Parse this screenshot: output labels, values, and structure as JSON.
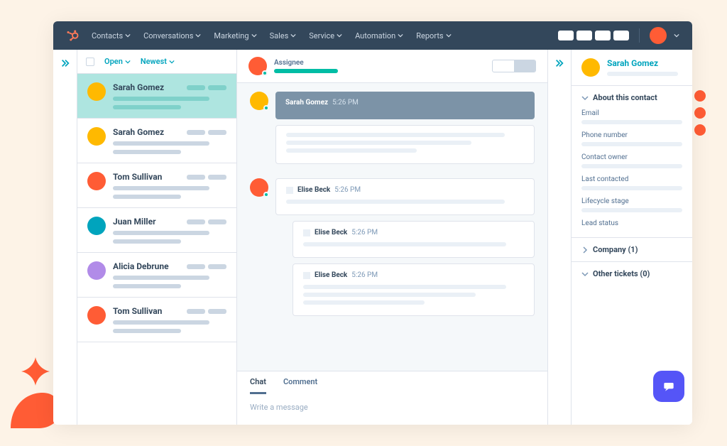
{
  "nav": {
    "items": [
      "Contacts",
      "Conversations",
      "Marketing",
      "Sales",
      "Service",
      "Automation",
      "Reports"
    ]
  },
  "filters": {
    "status": "Open",
    "sort": "Newest"
  },
  "conversations": [
    {
      "name": "Sarah Gomez",
      "avatar": "c1",
      "selected": true
    },
    {
      "name": "Sarah Gomez",
      "avatar": "c1",
      "selected": false
    },
    {
      "name": "Tom Sullivan",
      "avatar": "c2",
      "selected": false
    },
    {
      "name": "Juan Miller",
      "avatar": "c3",
      "selected": false
    },
    {
      "name": "Alicia Debrune",
      "avatar": "c4",
      "selected": false
    },
    {
      "name": "Tom Sullivan",
      "avatar": "c2",
      "selected": false
    }
  ],
  "thread": {
    "assignee_label": "Assignee",
    "groups": [
      {
        "avatar": "c1",
        "bubbles": [
          {
            "style": "dark",
            "name": "Sarah Gomez",
            "time": "5:26 PM",
            "lines": 0
          },
          {
            "style": "light",
            "name": "",
            "time": "",
            "lines": 3
          }
        ]
      },
      {
        "avatar": "c2",
        "bubbles": [
          {
            "style": "light",
            "name": "Elise Beck",
            "time": "5:26 PM",
            "lines": 1
          },
          {
            "style": "light nested",
            "name": "Elise Beck",
            "time": "5:26 PM",
            "lines": 1
          },
          {
            "style": "light nested",
            "name": "Elise Beck",
            "time": "5:26 PM",
            "lines": 3
          }
        ]
      }
    ]
  },
  "composer": {
    "tabs": [
      "Chat",
      "Comment"
    ],
    "active_tab": 0,
    "placeholder": "Write a message"
  },
  "right_panel": {
    "contact_name": "Sarah Gomez",
    "sections": {
      "about": "About this contact",
      "company": "Company (1)",
      "tickets": "Other tickets (0)"
    },
    "fields": [
      "Email",
      "Phone number",
      "Contact owner",
      "Last contacted",
      "Lifecycle stage",
      "Lead status"
    ]
  }
}
